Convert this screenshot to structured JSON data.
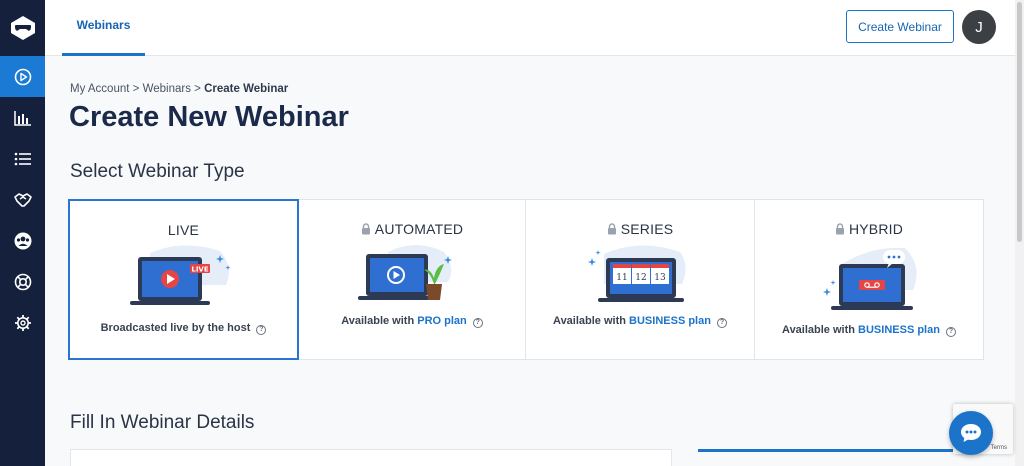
{
  "nav": {
    "items": [
      {
        "name": "webinars-icon",
        "active": true
      },
      {
        "name": "analytics-icon",
        "active": false
      },
      {
        "name": "list-icon",
        "active": false
      },
      {
        "name": "integrations-icon",
        "active": false
      },
      {
        "name": "users-icon",
        "active": false
      },
      {
        "name": "support-icon",
        "active": false
      },
      {
        "name": "settings-icon",
        "active": false
      }
    ]
  },
  "header": {
    "tab_label": "Webinars",
    "create_button": "Create Webinar",
    "avatar_initial": "J"
  },
  "breadcrumb": {
    "my_account": "My Account",
    "separator": ">",
    "webinars": "Webinars",
    "current": "Create Webinar"
  },
  "page_title": "Create New Webinar",
  "select_type_title": "Select Webinar Type",
  "cards": [
    {
      "title": "LIVE",
      "desc": "Broadcasted live by the host",
      "plan": "",
      "locked": false,
      "badge": "LIVE"
    },
    {
      "title": "AUTOMATED",
      "desc": "Available with",
      "plan": "PRO plan",
      "locked": true
    },
    {
      "title": "SERIES",
      "desc": "Available with",
      "plan": "BUSINESS plan",
      "locked": true,
      "dates": [
        "11",
        "12",
        "13"
      ]
    },
    {
      "title": "HYBRID",
      "desc": "Available with",
      "plan": "BUSINESS plan",
      "locked": true
    }
  ],
  "help_glyph": "?",
  "fill_details_title": "Fill In Webinar Details",
  "recaptcha_terms": "Terms",
  "colors": {
    "sidebar": "#14203c",
    "accent": "#1b74c9",
    "title": "#1b2a4a"
  }
}
